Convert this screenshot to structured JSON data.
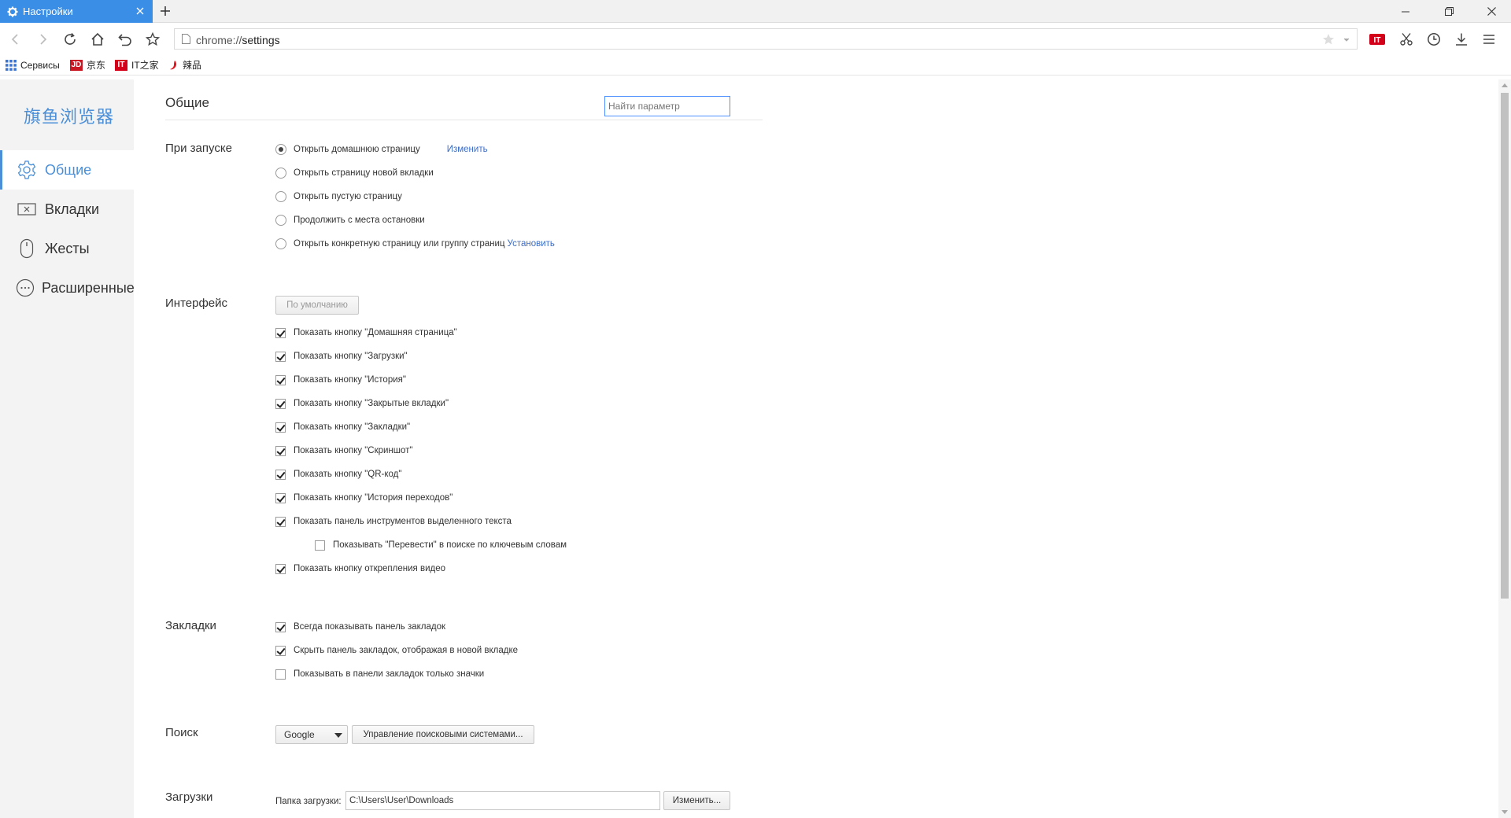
{
  "window": {
    "tab_title": "Настройки",
    "new_tab": "+",
    "minimize": "—",
    "close": "✕"
  },
  "toolbar": {
    "url_scheme": "chrome://",
    "url_path": "settings"
  },
  "bookmarks": [
    {
      "label": "Сервисы",
      "icon": "apps-grid-icon"
    },
    {
      "label": "京东",
      "icon": "jd-logo-icon",
      "badge": "JD",
      "color": "#c81623"
    },
    {
      "label": "IT之家",
      "icon": "ithome-logo-icon",
      "badge": "IT",
      "color": "#d4001a"
    },
    {
      "label": "辣品",
      "icon": "lapin-logo-icon"
    }
  ],
  "sidebar": {
    "logo": "旗鱼浏览器",
    "items": [
      {
        "label": "Общие",
        "icon": "gear-icon",
        "active": true
      },
      {
        "label": "Вкладки",
        "icon": "tab-close-icon",
        "active": false
      },
      {
        "label": "Жесты",
        "icon": "mouse-icon",
        "active": false
      },
      {
        "label": "Расширенные",
        "icon": "more-dots-icon",
        "active": false
      }
    ]
  },
  "content": {
    "title": "Общие",
    "search_placeholder": "Найти параметр",
    "startup": {
      "title": "При запуске",
      "options": [
        {
          "label": "Открыть домашнюю страницу",
          "selected": true,
          "link": "Изменить"
        },
        {
          "label": "Открыть страницу новой вкладки",
          "selected": false
        },
        {
          "label": "Открыть пустую страницу",
          "selected": false
        },
        {
          "label": "Продолжить с места остановки",
          "selected": false
        },
        {
          "label": "Открыть конкретную страницу или группу страниц",
          "selected": false,
          "link": "Установить"
        }
      ]
    },
    "interface": {
      "title": "Интерфейс",
      "default_button": "По умолчанию",
      "options": [
        {
          "label": "Показать кнопку \"Домашняя страница\"",
          "checked": true
        },
        {
          "label": "Показать кнопку \"Загрузки\"",
          "checked": true
        },
        {
          "label": "Показать кнопку \"История\"",
          "checked": true
        },
        {
          "label": "Показать кнопку \"Закрытые вкладки\"",
          "checked": true
        },
        {
          "label": "Показать кнопку \"Закладки\"",
          "checked": true
        },
        {
          "label": "Показать кнопку \"Скриншот\"",
          "checked": true
        },
        {
          "label": "Показать кнопку \"QR-код\"",
          "checked": true
        },
        {
          "label": "Показать кнопку \"История переходов\"",
          "checked": true
        },
        {
          "label": "Показать панель инструментов выделенного текста",
          "checked": true
        },
        {
          "label": "Показывать \"Перевести\" в поиске по ключевым словам",
          "checked": false
        },
        {
          "label": "Показать кнопку открепления видео",
          "checked": true
        }
      ]
    },
    "bookmarks": {
      "title": "Закладки",
      "options": [
        {
          "label": "Всегда показывать панель закладок",
          "checked": true
        },
        {
          "label": "Скрыть панель закладок, отображая в новой вкладке",
          "checked": true
        },
        {
          "label": "Показывать в панели закладок только значки",
          "checked": false
        }
      ]
    },
    "search": {
      "title": "Поиск",
      "engine": "Google",
      "manage_button": "Управление поисковыми системами..."
    },
    "downloads": {
      "title": "Загрузки",
      "folder_label": "Папка загрузки:",
      "folder_value": "C:\\Users\\User\\Downloads",
      "change_button": "Изменить..."
    }
  },
  "colors": {
    "accent": "#4a8fd8",
    "tab_active": "#3a8ee6",
    "link": "#3b6cc7"
  }
}
